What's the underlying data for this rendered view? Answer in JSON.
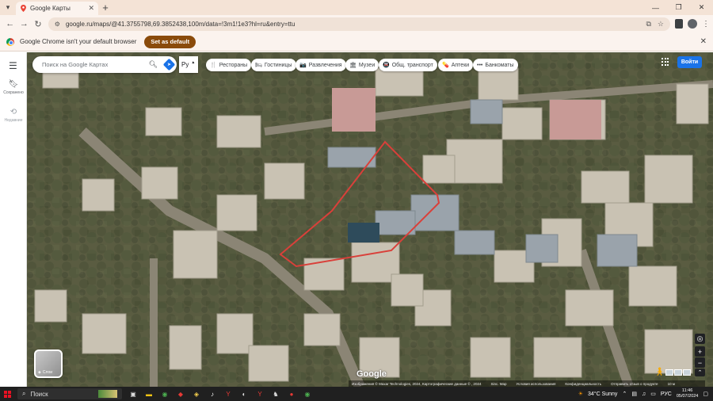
{
  "browser": {
    "tab_title": "Google Карты",
    "url": "google.ru/maps/@41.3755798,69.3852438,100m/data=!3m1!1e3?hl=ru&entry=ttu",
    "infobar_text": "Google Chrome isn't your default browser",
    "set_default_label": "Set as default"
  },
  "maps": {
    "search_placeholder": "Поиск на Google Картах",
    "lang_label": "Ру",
    "rail": {
      "saved_label": "Сохранено",
      "recent_label": "Недавние"
    },
    "chips": [
      {
        "icon": "restaurant-icon",
        "glyph": "🍴",
        "label": "Рестораны"
      },
      {
        "icon": "hotel-icon",
        "glyph": "🛏",
        "label": "Гостиницы"
      },
      {
        "icon": "camera-icon",
        "glyph": "📷",
        "label": "Развлечения"
      },
      {
        "icon": "museum-icon",
        "glyph": "🏛",
        "label": "Музеи"
      },
      {
        "icon": "transit-icon",
        "glyph": "🚇",
        "label": "Общ. транспорт"
      },
      {
        "icon": "pharmacy-icon",
        "glyph": "💊",
        "label": "Аптеки"
      },
      {
        "icon": "atm-icon",
        "glyph": "•••",
        "label": "Банкоматы"
      }
    ],
    "signin_label": "Войти",
    "layers_label": "Слои",
    "google_logo": "Google",
    "attribution": [
      "Изображения © Maxar Technologies, 2024, Картографические данные © , 2024",
      "Sinc. Map",
      "Условия использования",
      "Конфиденциальность",
      "Отправить отзыв о продукте",
      "10 м"
    ],
    "highlight_color": "#d9403a"
  },
  "taskbar": {
    "search_label": "Поиск",
    "weather": "34°C  Sunny",
    "lang": "РУС",
    "time": "11:46",
    "date": "05/07/2024"
  }
}
